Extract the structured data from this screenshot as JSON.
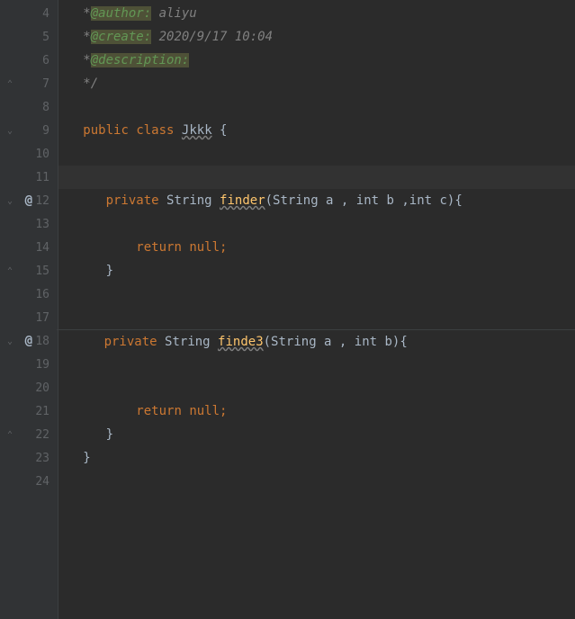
{
  "lines": {
    "l4": {
      "num": "4",
      "prefix": "   *",
      "tag": "@author:",
      "value": " aliyu"
    },
    "l5": {
      "num": "5",
      "prefix": "   *",
      "tag": "@create:",
      "value": " 2020/9/17 10:04"
    },
    "l6": {
      "num": "6",
      "prefix": "   *",
      "tag": "@description:",
      "value": ""
    },
    "l7": {
      "num": "7",
      "text": "   */"
    },
    "l8": {
      "num": "8"
    },
    "l9": {
      "num": "9",
      "kw1": "public",
      "kw2": "class",
      "name": "Jkkk",
      "brace": " {"
    },
    "l10": {
      "num": "10"
    },
    "l11": {
      "num": "11"
    },
    "l12": {
      "num": "12",
      "kw": "private",
      "type": "String",
      "method": "finder",
      "params": "(String a , int b ,int c){"
    },
    "l13": {
      "num": "13"
    },
    "l14": {
      "num": "14",
      "kw": "return",
      "nul": "null",
      "semi": ";"
    },
    "l15": {
      "num": "15",
      "brace": "      }"
    },
    "l16": {
      "num": "16"
    },
    "l17": {
      "num": "17"
    },
    "l18": {
      "num": "18",
      "kw": "private",
      "type": "String",
      "method": "finde3",
      "params": "(String a , int b){"
    },
    "l19": {
      "num": "19"
    },
    "l20": {
      "num": "20"
    },
    "l21": {
      "num": "21",
      "kw": "return",
      "nul": "null",
      "semi": ";"
    },
    "l22": {
      "num": "22",
      "brace": "      }"
    },
    "l23": {
      "num": "23",
      "brace": "   }"
    },
    "l24": {
      "num": "24"
    }
  },
  "annotations": {
    "at": "@"
  }
}
